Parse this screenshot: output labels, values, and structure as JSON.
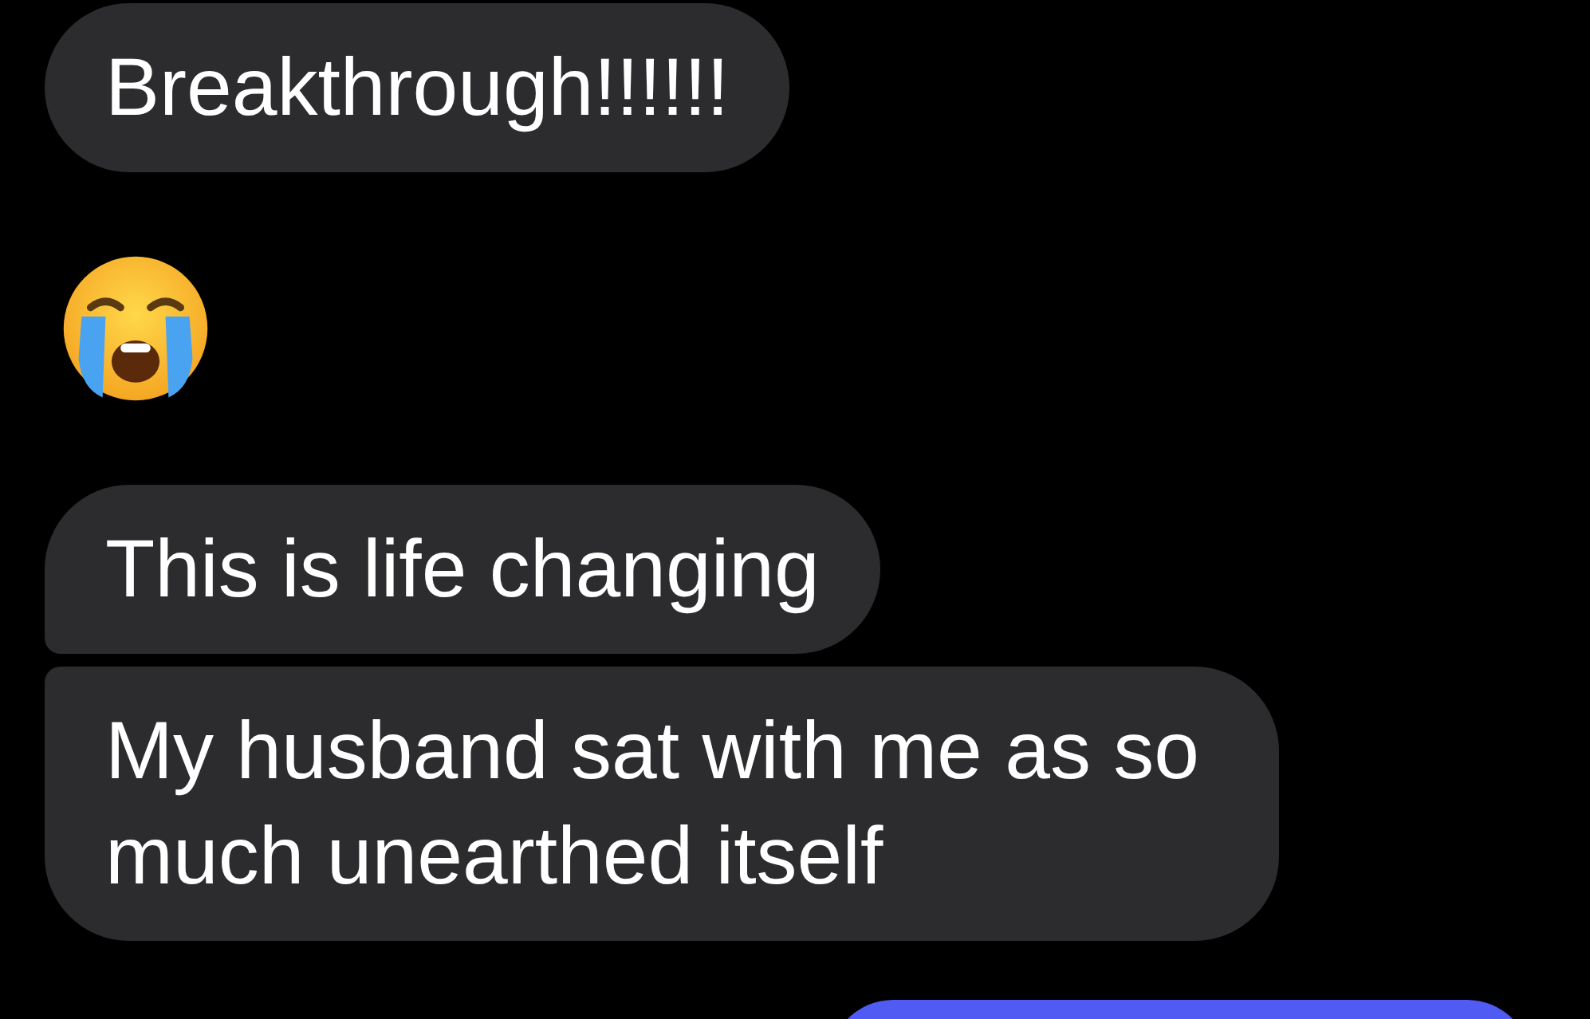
{
  "messages": [
    {
      "kind": "text",
      "text": "Breakthrough!!!!!!",
      "grouped_with_next": false
    },
    {
      "kind": "emoji",
      "grouped_with_next": false
    },
    {
      "kind": "text",
      "text": "This is life changing",
      "grouped_with_next": true
    },
    {
      "kind": "text",
      "text": "My husband sat with me as so much unearthed itself",
      "grouped_with_next": false
    },
    {
      "kind": "outgoing",
      "grouped_with_next": false
    }
  ]
}
